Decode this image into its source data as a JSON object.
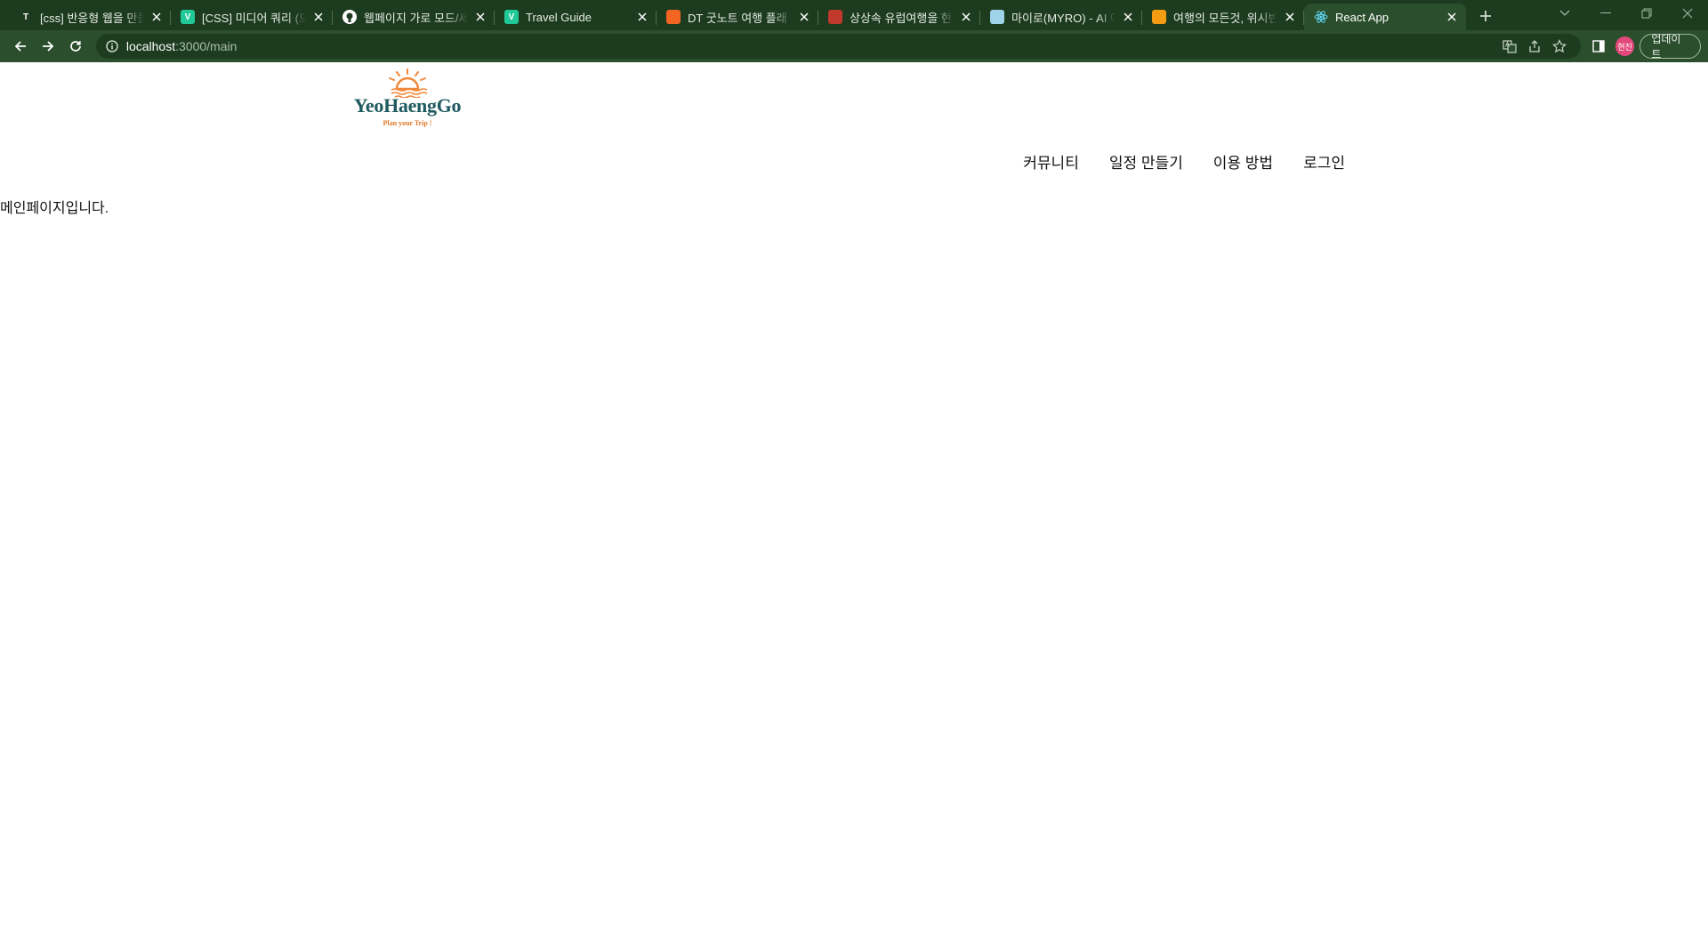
{
  "browser": {
    "tabs": [
      {
        "title": "[css] 반응형 웹을 만들",
        "favicon_color": "#1d3b1f",
        "favicon_glyph": "T",
        "icon": "tistory-icon"
      },
      {
        "title": "[CSS] 미디어 쿼리 (모",
        "favicon_color": "#20c997",
        "favicon_glyph": "V",
        "icon": "velog-icon"
      },
      {
        "title": "웹페이지 가로 모드/세",
        "favicon_color": "#ffffff",
        "favicon_glyph": "",
        "icon": "github-icon"
      },
      {
        "title": "Travel Guide",
        "favicon_color": "#20c997",
        "favicon_glyph": "V",
        "icon": "velog-icon"
      },
      {
        "title": "DT 굿노트 여행 플래",
        "favicon_color": "#f26522",
        "favicon_glyph": "",
        "icon": "brand-icon"
      },
      {
        "title": "상상속 유럽여행을 현",
        "favicon_color": "#c0392b",
        "favicon_glyph": "",
        "icon": "brand-icon"
      },
      {
        "title": "마이로(MYRO) - AI 여",
        "favicon_color": "#9fd4e8",
        "favicon_glyph": "",
        "icon": "myro-icon"
      },
      {
        "title": "여행의 모든것, 위시빈",
        "favicon_color": "#f39c12",
        "favicon_glyph": "",
        "icon": "wishbeen-icon"
      },
      {
        "title": "React App",
        "favicon_color": "#61dafb",
        "favicon_glyph": "",
        "icon": "react-icon",
        "active": true
      }
    ],
    "url_host": "localhost",
    "url_path": ":3000/main",
    "profile_initials": "현진",
    "update_label": "업데이트"
  },
  "page": {
    "logo": {
      "wordmark": "YeoHaengGo",
      "tagline": "Plan your Trip !",
      "sun_color": "#f0883a",
      "text_color": "#1e5a5f"
    },
    "nav": [
      {
        "label": "커뮤니티"
      },
      {
        "label": "일정 만들기"
      },
      {
        "label": "이용 방법"
      },
      {
        "label": "로그인"
      }
    ],
    "main_text": "메인페이지입니다."
  }
}
